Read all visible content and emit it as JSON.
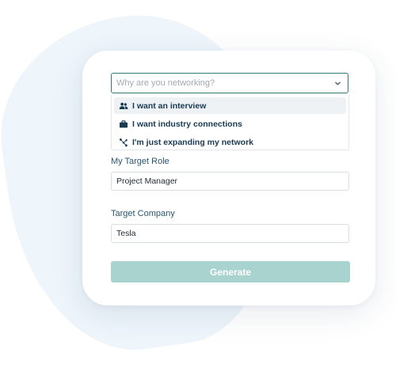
{
  "form": {
    "reason_select": {
      "placeholder": "Why are you networking?",
      "options": [
        {
          "label": "I want an interview",
          "icon": "people-icon",
          "highlighted": true
        },
        {
          "label": "I want industry connections",
          "icon": "briefcase-icon",
          "highlighted": false
        },
        {
          "label": "I'm just expanding my network",
          "icon": "network-icon",
          "highlighted": false
        }
      ]
    },
    "target_role": {
      "label": "My Target Role",
      "value": "Project Manager"
    },
    "target_company": {
      "label": "Target Company",
      "value": "Tesla"
    },
    "generate_label": "Generate"
  },
  "colors": {
    "accent": "#2f7d7a",
    "button_disabled": "#a9d3cf",
    "text_dark": "#183a52",
    "label": "#2b5670",
    "background_blob": "#eef5fb"
  }
}
